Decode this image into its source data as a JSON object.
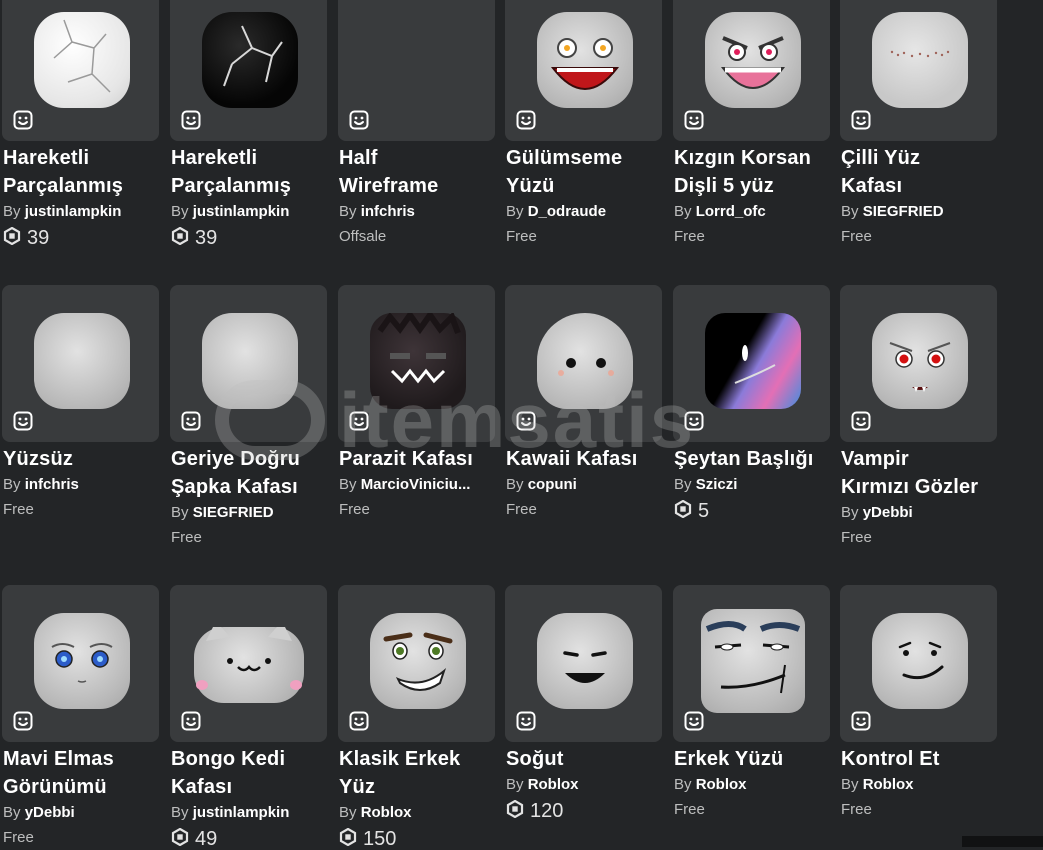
{
  "items": [
    {
      "name_line1": "Hareketli",
      "name_line2": "Parçalanmış",
      "by": "By",
      "creator": "justinlampkin",
      "price": "39",
      "price_type": "robux",
      "icon": "white-cracked-head"
    },
    {
      "name_line1": "Hareketli",
      "name_line2": "Parçalanmış",
      "by": "By",
      "creator": "justinlampkin",
      "price": "39",
      "price_type": "robux",
      "icon": "black-cracked-head"
    },
    {
      "name_line1": "Half",
      "name_line2": "Wireframe",
      "by": "By",
      "creator": "infchris",
      "price": "Offsale",
      "price_type": "text",
      "icon": "empty"
    },
    {
      "name_line1": "Gülümseme",
      "name_line2": "Yüzü",
      "by": "By",
      "creator": "D_odraude",
      "price": "Free",
      "price_type": "text",
      "icon": "smile-head"
    },
    {
      "name_line1": "Kızgın Korsan",
      "name_line2": "Dişli 5 yüz",
      "by": "By",
      "creator": "Lorrd_ofc",
      "price": "Free",
      "price_type": "text",
      "icon": "angry-head"
    },
    {
      "name_line1": "Çilli Yüz",
      "name_line2": "Kafası",
      "by": "By",
      "creator": "SIEGFRIED",
      "price": "Free",
      "price_type": "text",
      "icon": "freckle-head"
    },
    {
      "name_line1": "Yüzsüz",
      "name_line2": "",
      "by": "By",
      "creator": "infchris",
      "price": "Free",
      "price_type": "text",
      "icon": "blank-head"
    },
    {
      "name_line1": "Geriye Doğru",
      "name_line2": "Şapka Kafası",
      "by": "By",
      "creator": "SIEGFRIED",
      "price": "Free",
      "price_type": "text",
      "icon": "blank-head"
    },
    {
      "name_line1": "Parazit Kafası",
      "name_line2": "",
      "by": "By",
      "creator": "MarcioViniciu...",
      "price": "Free",
      "price_type": "text",
      "icon": "parasite-head"
    },
    {
      "name_line1": "Kawaii Kafası",
      "name_line2": "",
      "by": "By",
      "creator": "copuni",
      "price": "Free",
      "price_type": "text",
      "icon": "kawaii-head"
    },
    {
      "name_line1": "Şeytan Başlığı",
      "name_line2": "",
      "by": "By",
      "creator": "Sziczi",
      "price": "5",
      "price_type": "robux",
      "icon": "demon-head"
    },
    {
      "name_line1": "Vampir",
      "name_line2": "Kırmızı Gözler",
      "by": "By",
      "creator": "yDebbi",
      "price": "Free",
      "price_type": "text",
      "icon": "vampire-head"
    },
    {
      "name_line1": "Mavi Elmas",
      "name_line2": "Görünümü",
      "by": "By",
      "creator": "yDebbi",
      "price": "Free",
      "price_type": "text",
      "icon": "blue-eyes-head"
    },
    {
      "name_line1": "Bongo Kedi",
      "name_line2": "Kafası",
      "by": "By",
      "creator": "justinlampkin",
      "price": "49",
      "price_type": "robux",
      "icon": "cat-head"
    },
    {
      "name_line1": "Klasik Erkek",
      "name_line2": "Yüz",
      "by": "By",
      "creator": "Roblox",
      "price": "150",
      "price_type": "robux",
      "icon": "classic-head"
    },
    {
      "name_line1": "Soğut",
      "name_line2": "",
      "by": "By",
      "creator": "Roblox",
      "price": "120",
      "price_type": "robux",
      "icon": "chill-head"
    },
    {
      "name_line1": "Erkek Yüzü",
      "name_line2": "",
      "by": "By",
      "creator": "Roblox",
      "price": "Free",
      "price_type": "text",
      "icon": "man-face-head"
    },
    {
      "name_line1": "Kontrol Et",
      "name_line2": "",
      "by": "By",
      "creator": "Roblox",
      "price": "Free",
      "price_type": "text",
      "icon": "check-it-head"
    }
  ],
  "watermark": {
    "text": "itemsatis"
  }
}
